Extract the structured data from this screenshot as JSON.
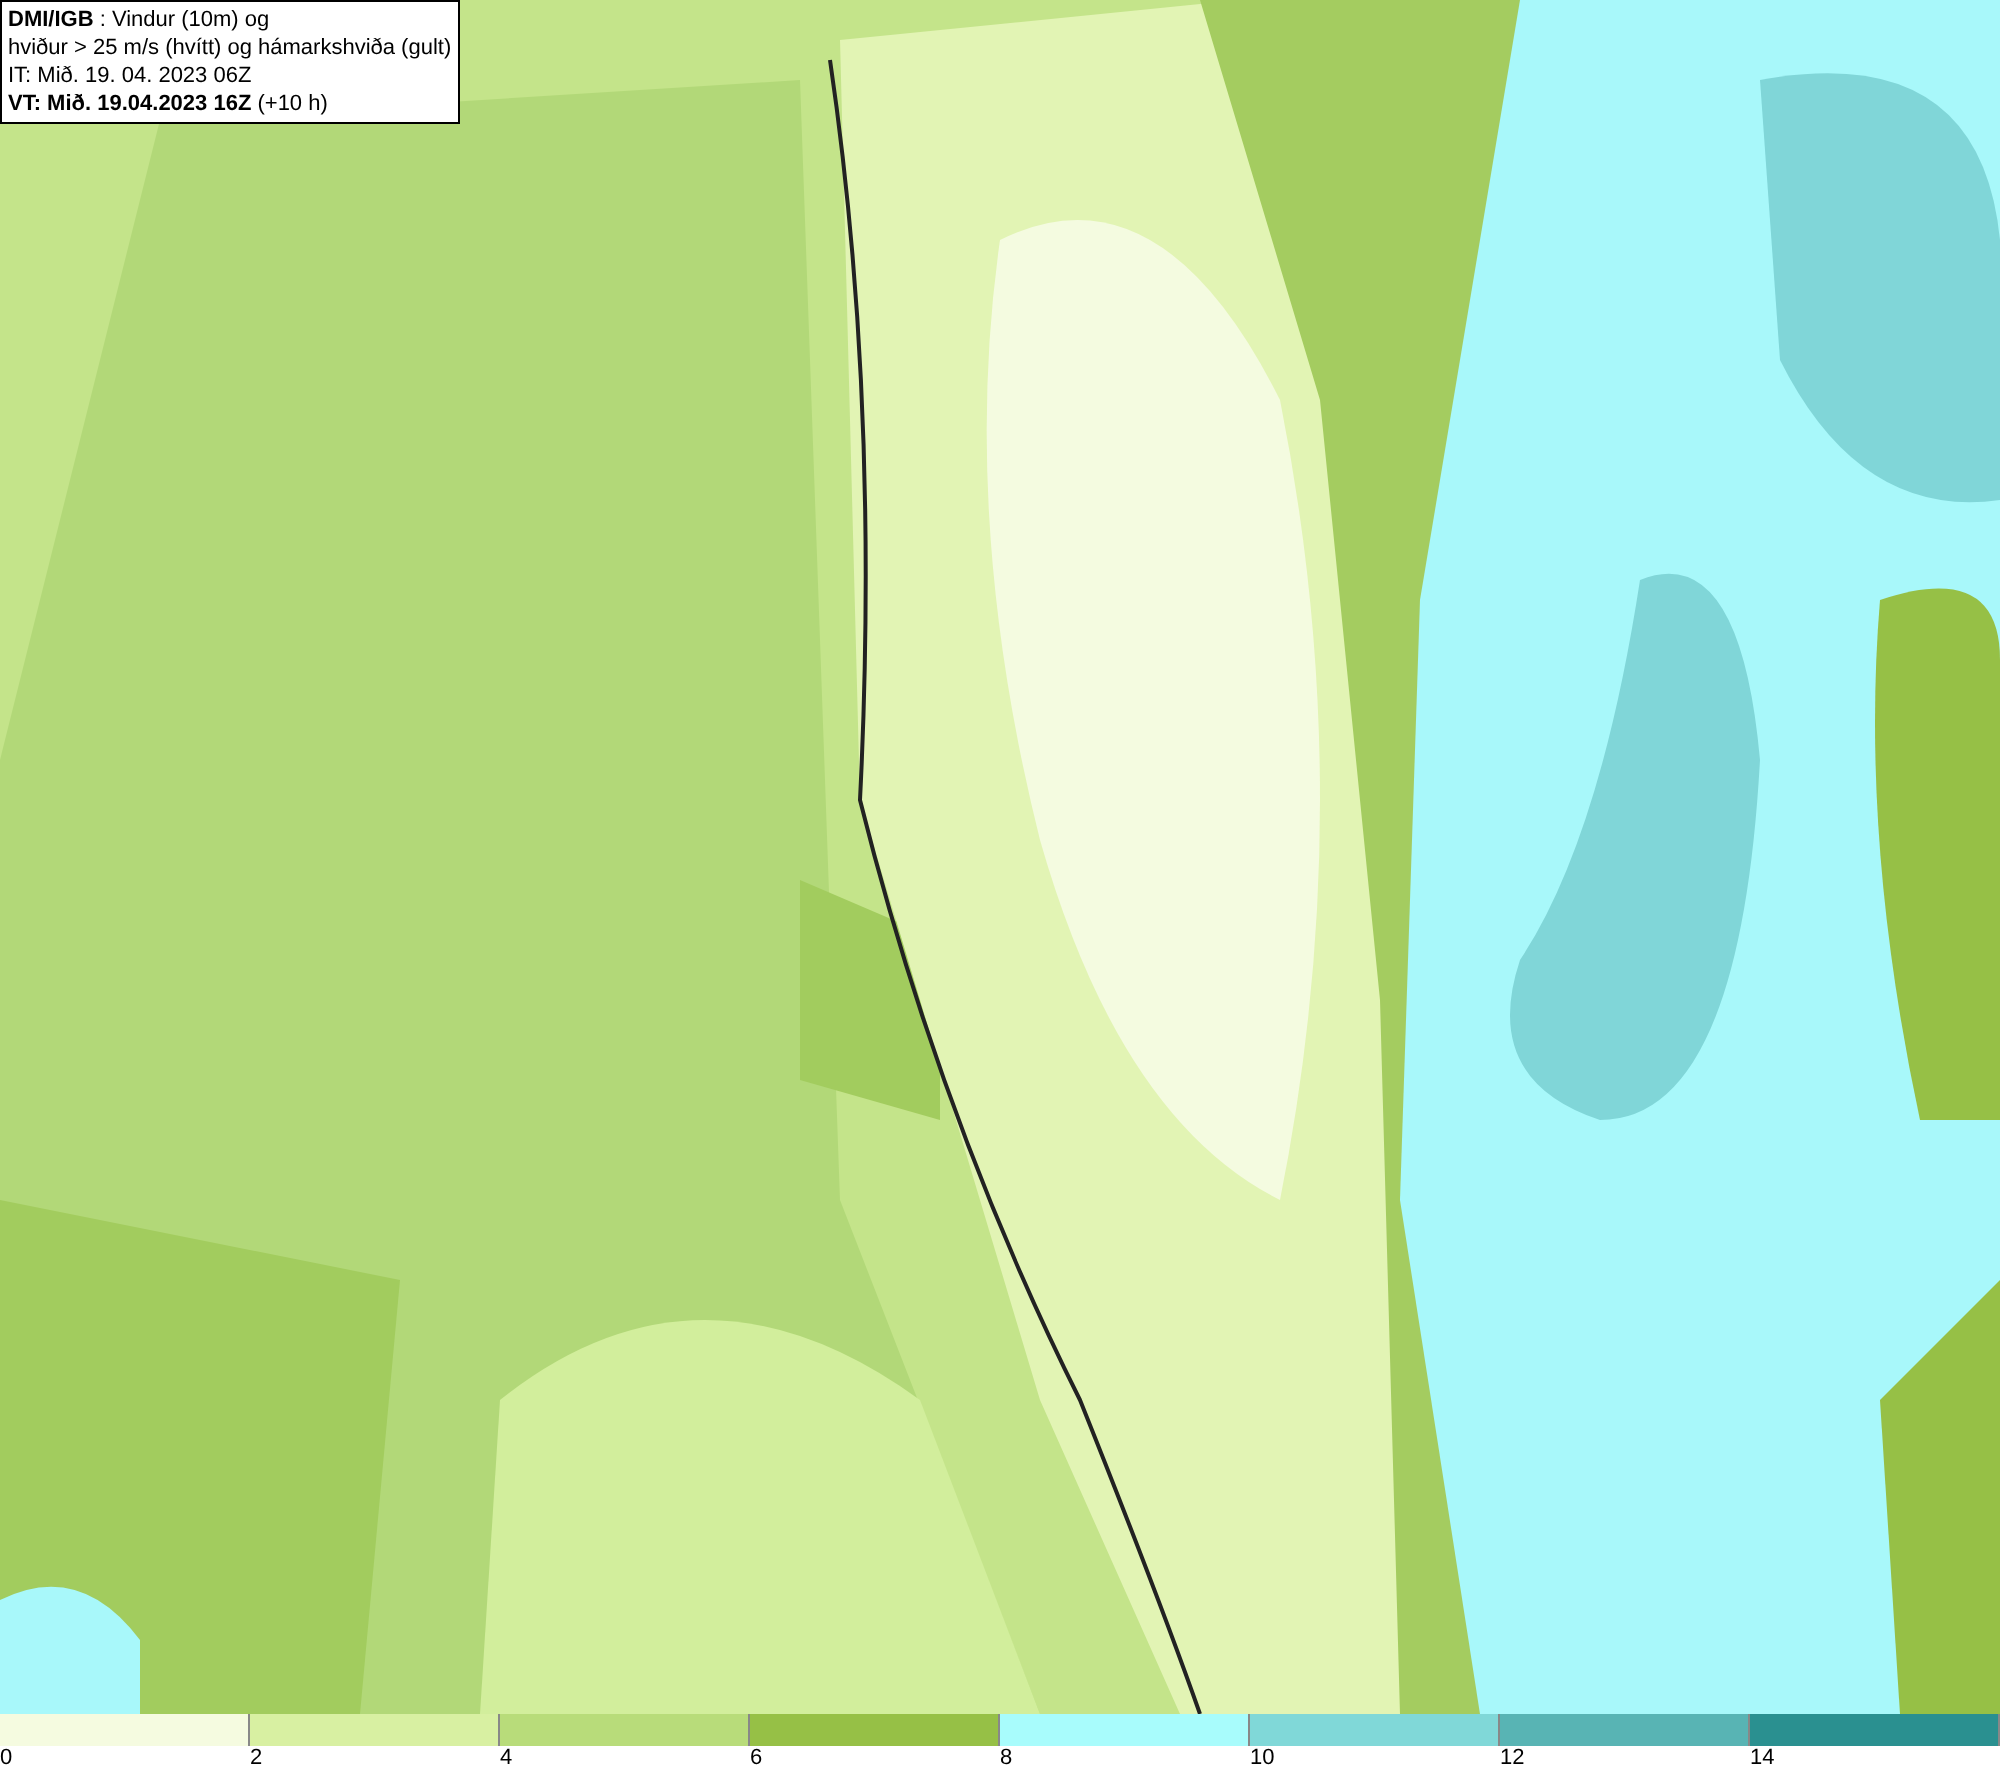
{
  "legend": {
    "lines": [
      "**DMI/IGB** : Vindur (10m) og",
      "hviður > 25 m/s (hvítt) og hámarkshviða (gult)",
      "IT: Mið. 19. 04. 2023 06Z",
      "**VT: Mið. 19.04.2023 16Z** (+10 h)"
    ]
  },
  "colorbar": {
    "segments": [
      {
        "label": "0",
        "color": "#f5fbe0"
      },
      {
        "label": "2",
        "color": "#d8f0a2"
      },
      {
        "label": "4",
        "color": "#b8dc7a"
      },
      {
        "label": "6",
        "color": "#96c046"
      },
      {
        "label": "8",
        "color": "#a8fcfc"
      },
      {
        "label": "10",
        "color": "#80d8d8"
      },
      {
        "label": "12",
        "color": "#58b4b4"
      },
      {
        "label": "14",
        "color": "#2a9090"
      }
    ]
  }
}
